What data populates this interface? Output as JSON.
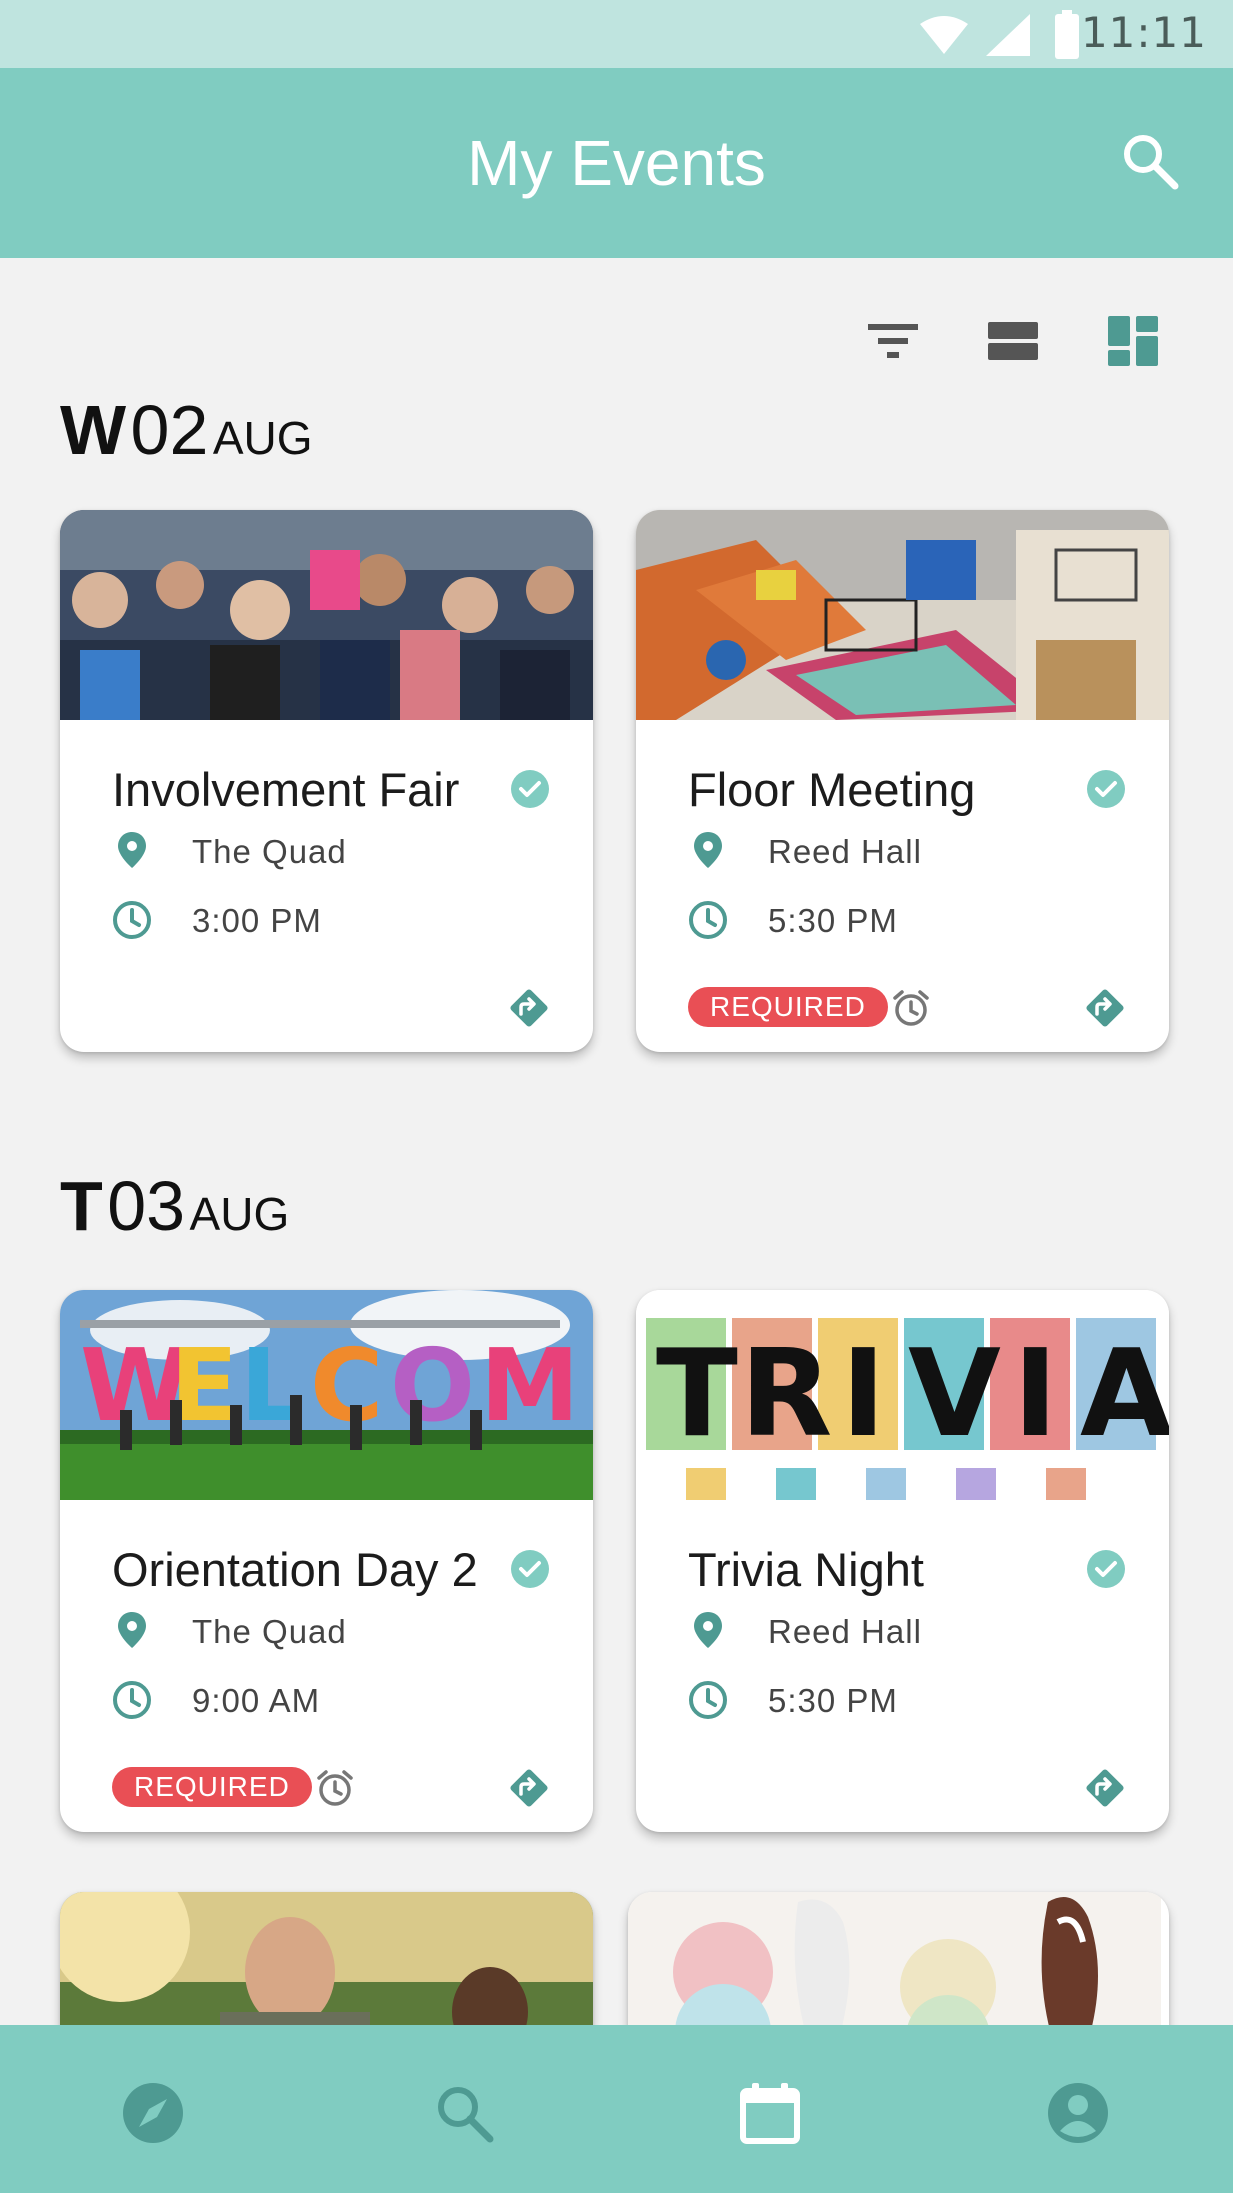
{
  "status_bar": {
    "time": "11:11"
  },
  "app_bar": {
    "title": "My Events"
  },
  "toolbar": {
    "icons": [
      "filter-icon",
      "list-view-icon",
      "grid-view-icon"
    ]
  },
  "days": [
    {
      "dow": "W",
      "num": "02",
      "month": "AUG",
      "events": [
        {
          "title": "Involvement Fair",
          "location": "The Quad",
          "time": "3:00 PM",
          "checked": true,
          "required": false
        },
        {
          "title": "Floor Meeting",
          "location": "Reed Hall",
          "time": "5:30 PM",
          "checked": true,
          "required": true,
          "badge": "REQUIRED"
        }
      ]
    },
    {
      "dow": "T",
      "num": "03",
      "month": "AUG",
      "events": [
        {
          "title": "Orientation Day 2",
          "location": "The Quad",
          "time": "9:00 AM",
          "checked": true,
          "required": true,
          "badge": "REQUIRED"
        },
        {
          "title": "Trivia Night",
          "location": "Reed Hall",
          "time": "5:30 PM",
          "checked": true,
          "required": false
        }
      ]
    }
  ],
  "trivia_banner": {
    "letters": [
      "T",
      "R",
      "I",
      "V",
      "I",
      "A"
    ]
  },
  "bottom_nav": {
    "items": [
      "explore-icon",
      "search-icon",
      "calendar-icon",
      "profile-icon"
    ],
    "active": "calendar-icon"
  },
  "colors": {
    "primary": "#80CCC1",
    "accent_dark": "#4E9A92",
    "required": "#E94F55",
    "background": "#F2F2F2"
  }
}
